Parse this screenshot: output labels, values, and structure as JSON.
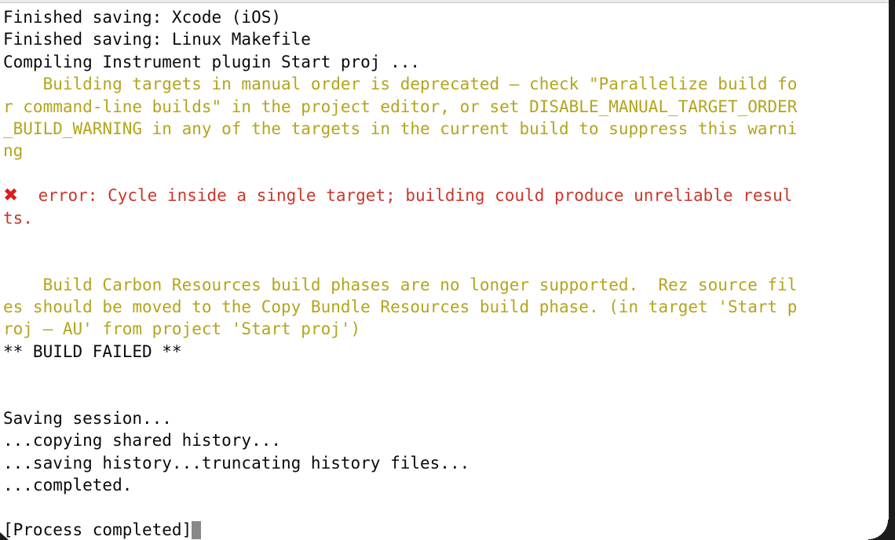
{
  "window": {
    "app": "Terminal",
    "type": "macos-terminal-window",
    "colors": {
      "background": "#ffffff",
      "normal_text": "#0a0a0a",
      "warning_text": "#b3a51c",
      "error_text": "#c9372c",
      "error_mark": "#d81f1f",
      "cursor": "#888888",
      "window_chrome": "#ececec",
      "outside_frame": "#1d1d1d"
    }
  },
  "terminal": {
    "lines": [
      {
        "id": "line-1",
        "style": "normal",
        "text": "Finished saving: Xcode (iOS)"
      },
      {
        "id": "line-2",
        "style": "normal",
        "text": "Finished saving: Linux Makefile"
      },
      {
        "id": "line-3",
        "style": "normal",
        "text": "Compiling Instrument plugin Start proj ..."
      },
      {
        "id": "line-4",
        "style": "warning",
        "text": "    Building targets in manual order is deprecated — check \"Parallelize build fo"
      },
      {
        "id": "line-5",
        "style": "warning",
        "text": "r command-line builds\" in the project editor, or set DISABLE_MANUAL_TARGET_ORDER"
      },
      {
        "id": "line-6",
        "style": "warning",
        "text": "_BUILD_WARNING in any of the targets in the current build to suppress this warni"
      },
      {
        "id": "line-7",
        "style": "warning",
        "text": "ng"
      },
      {
        "id": "line-8",
        "style": "normal",
        "text": ""
      },
      {
        "id": "line-9",
        "style": "error-mark",
        "mark": "✖",
        "text": "  error: Cycle inside a single target; building could produce unreliable resul"
      },
      {
        "id": "line-10",
        "style": "error",
        "text": "ts."
      },
      {
        "id": "line-11",
        "style": "normal",
        "text": ""
      },
      {
        "id": "line-12",
        "style": "normal",
        "text": ""
      },
      {
        "id": "line-13",
        "style": "warning",
        "text": "    Build Carbon Resources build phases are no longer supported.  Rez source fil"
      },
      {
        "id": "line-14",
        "style": "warning",
        "text": "es should be moved to the Copy Bundle Resources build phase. (in target 'Start p"
      },
      {
        "id": "line-15",
        "style": "warning",
        "text": "roj — AU' from project 'Start proj')"
      },
      {
        "id": "line-16",
        "style": "normal",
        "text": "** BUILD FAILED **"
      },
      {
        "id": "line-17",
        "style": "normal",
        "text": ""
      },
      {
        "id": "line-18",
        "style": "normal",
        "text": ""
      },
      {
        "id": "line-19",
        "style": "normal",
        "text": "Saving session..."
      },
      {
        "id": "line-20",
        "style": "normal",
        "text": "...copying shared history..."
      },
      {
        "id": "line-21",
        "style": "normal",
        "text": "...saving history...truncating history files..."
      },
      {
        "id": "line-22",
        "style": "normal",
        "text": "...completed."
      },
      {
        "id": "line-23",
        "style": "normal",
        "text": ""
      },
      {
        "id": "line-24",
        "style": "cursor",
        "text": "[Process completed]"
      }
    ]
  }
}
